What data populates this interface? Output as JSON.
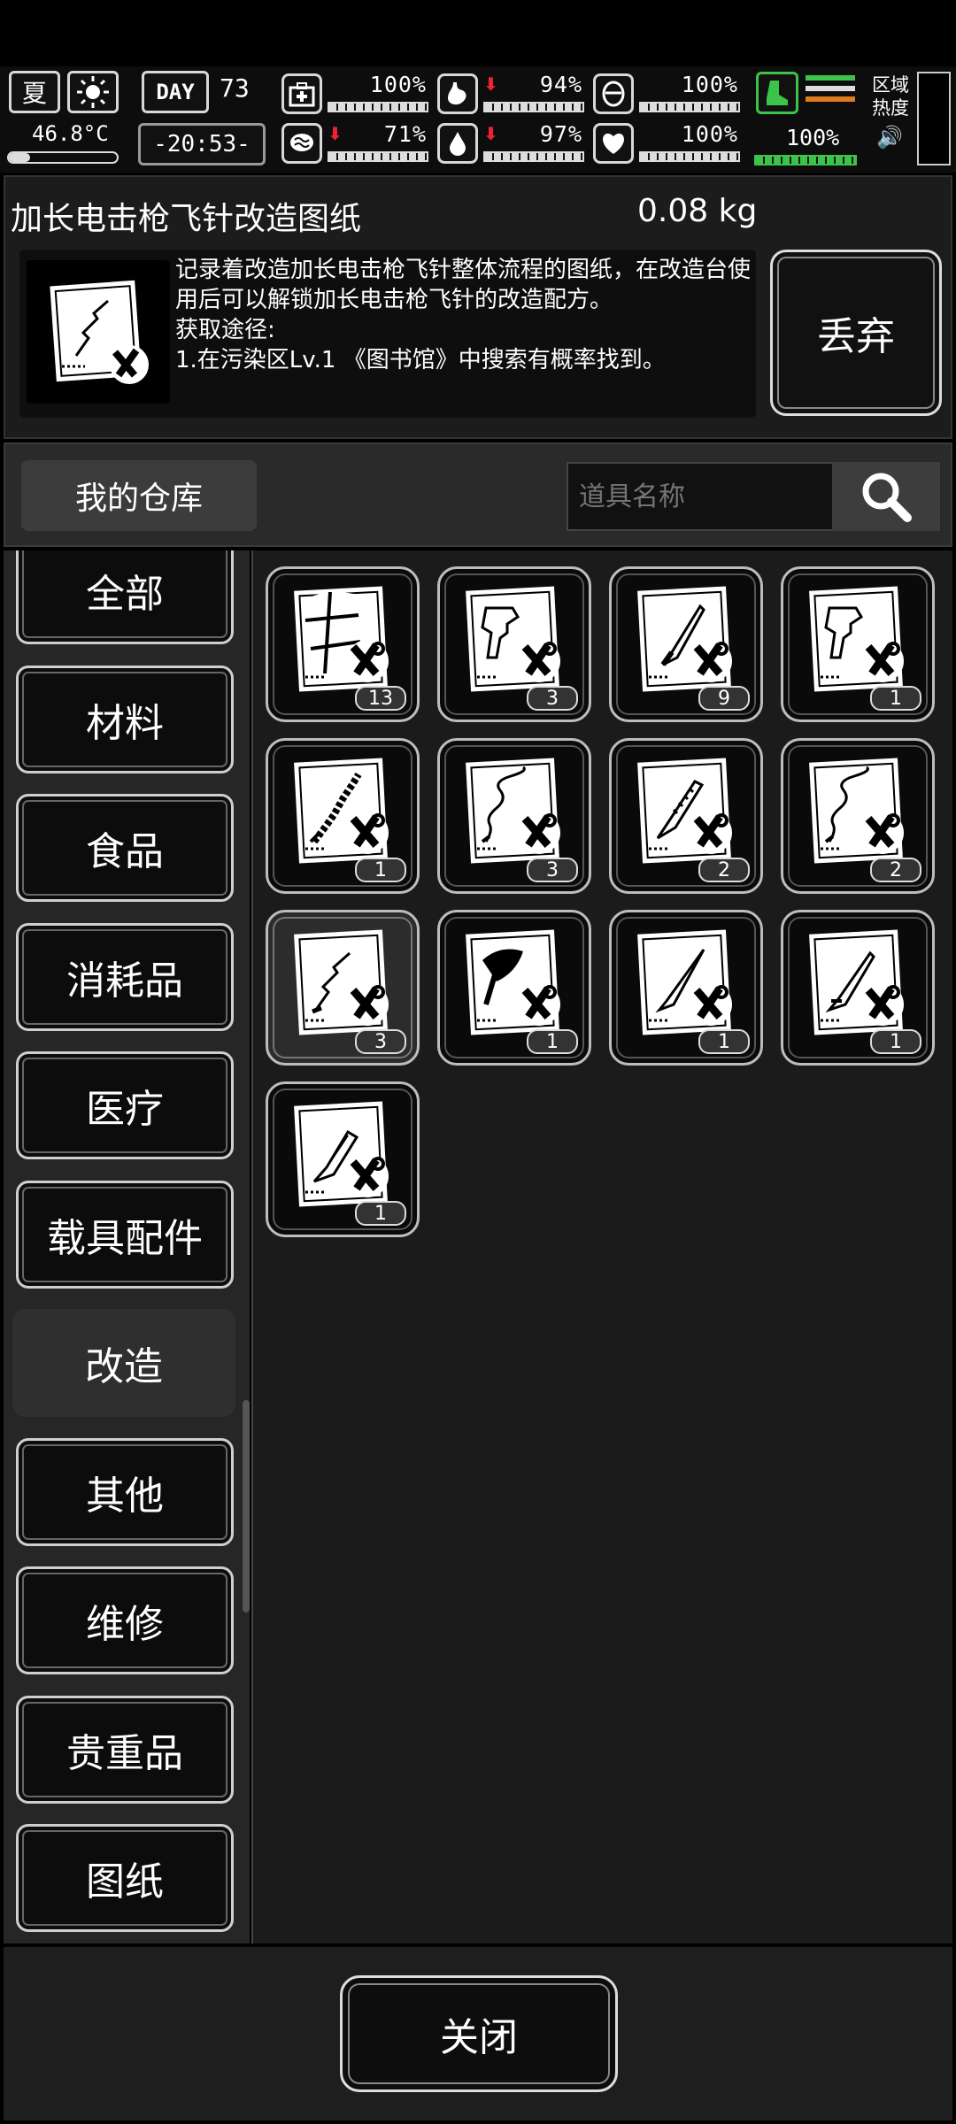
{
  "status": {
    "season": "夏",
    "temperature": "46.8°C",
    "day_label": "DAY",
    "day_number": "73",
    "clock": "-20:53-",
    "stats": [
      {
        "name": "health",
        "value": "100%",
        "drop": false,
        "level": 1.0
      },
      {
        "name": "hunger",
        "value": "94%",
        "drop": true,
        "level": 0.94
      },
      {
        "name": "armor",
        "value": "100%",
        "drop": false,
        "level": 1.0
      },
      {
        "name": "mood",
        "value": "71%",
        "drop": true,
        "level": 0.71
      },
      {
        "name": "thirst",
        "value": "97%",
        "drop": true,
        "level": 0.97
      },
      {
        "name": "heart",
        "value": "100%",
        "drop": false,
        "level": 1.0
      }
    ],
    "stamina": {
      "value": "100%",
      "level": 1.0
    },
    "zone_heat_label": "区域\n热度",
    "colors": {
      "stamina": "#3cc34a",
      "warn": "#ee3333"
    }
  },
  "item": {
    "name": "加长电击枪飞针改造图纸",
    "weight": "0.08 kg",
    "description": "记录着改造加长电击枪飞针整体流程的图纸，在改造台使用后可以解锁加长电击枪飞针的改造配方。\n获取途径:\n1.在污染区Lv.1 《图书馆》中搜索有概率找到。",
    "discard_label": "丢弃"
  },
  "warehouse": {
    "label": "我的仓库",
    "search_placeholder": "道具名称"
  },
  "categories": [
    {
      "label": "全部",
      "selected": false
    },
    {
      "label": "材料",
      "selected": false
    },
    {
      "label": "食品",
      "selected": false
    },
    {
      "label": "消耗品",
      "selected": false
    },
    {
      "label": "医疗",
      "selected": false
    },
    {
      "label": "载具配件",
      "selected": false
    },
    {
      "label": "改造",
      "selected": true
    },
    {
      "label": "其他",
      "selected": false
    },
    {
      "label": "维修",
      "selected": false
    },
    {
      "label": "贵重品",
      "selected": false
    },
    {
      "label": "图纸",
      "selected": false
    }
  ],
  "items": [
    {
      "icon": "torn-blueprint",
      "count": "13"
    },
    {
      "icon": "trigger-blueprint",
      "count": "3"
    },
    {
      "icon": "blade-blueprint",
      "count": "9"
    },
    {
      "icon": "trigger-blueprint",
      "count": "1"
    },
    {
      "icon": "chain-blueprint",
      "count": "1"
    },
    {
      "icon": "wire-blueprint",
      "count": "3"
    },
    {
      "icon": "saw-blade-blueprint",
      "count": "2"
    },
    {
      "icon": "wire-blueprint",
      "count": "2"
    },
    {
      "icon": "lightning-blueprint",
      "count": "3",
      "selected": true
    },
    {
      "icon": "axe-blueprint",
      "count": "1"
    },
    {
      "icon": "spike-blueprint",
      "count": "1"
    },
    {
      "icon": "knife-blueprint",
      "count": "1"
    },
    {
      "icon": "cleaver-blueprint",
      "count": "1"
    }
  ],
  "close_label": "关闭"
}
